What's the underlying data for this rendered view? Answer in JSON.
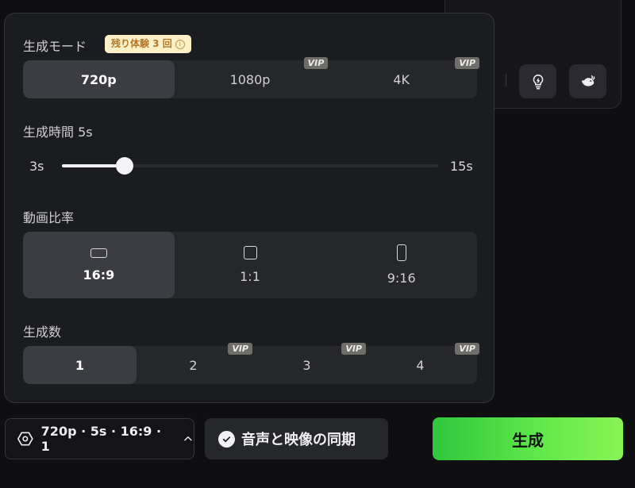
{
  "mode": {
    "label": "生成モード",
    "trial_badge": "残り体験 3 回",
    "info_glyph": "i",
    "vip_label": "VIP",
    "options": [
      {
        "label": "720p",
        "active": true,
        "vip": false
      },
      {
        "label": "1080p",
        "active": false,
        "vip": true
      },
      {
        "label": "4K",
        "active": false,
        "vip": true
      }
    ]
  },
  "duration": {
    "label": "生成時間 5s",
    "min_label": "3s",
    "max_label": "15s",
    "min": 3,
    "max": 15,
    "value": 5
  },
  "aspect": {
    "label": "動画比率",
    "options": [
      {
        "label": "16:9",
        "active": true,
        "icon": "landscape-rect-icon"
      },
      {
        "label": "1:1",
        "active": false,
        "icon": "square-icon"
      },
      {
        "label": "9:16",
        "active": false,
        "icon": "portrait-rect-icon"
      }
    ]
  },
  "count": {
    "label": "生成数",
    "vip_label": "VIP",
    "options": [
      {
        "label": "1",
        "active": true,
        "vip": false
      },
      {
        "label": "2",
        "active": false,
        "vip": true
      },
      {
        "label": "3",
        "active": false,
        "vip": true
      },
      {
        "label": "4",
        "active": false,
        "vip": true
      }
    ]
  },
  "bottom_bar": {
    "summary": "720p · 5s · 16:9 · 1",
    "summary_icon": "hexagon-settings-icon",
    "chevron_icon": "chevron-up-icon",
    "sync_label": "音声と映像の同期",
    "sync_icon": "check-circle-icon",
    "generate_label": "生成"
  },
  "background_card": {
    "icons": [
      "lightbulb-icon",
      "whale-icon"
    ]
  },
  "colors": {
    "accent_green": "#5fe84a",
    "panel_bg": "#1b1c1f",
    "badge_bg": "#fdf0c6",
    "badge_text": "#b4792a"
  }
}
